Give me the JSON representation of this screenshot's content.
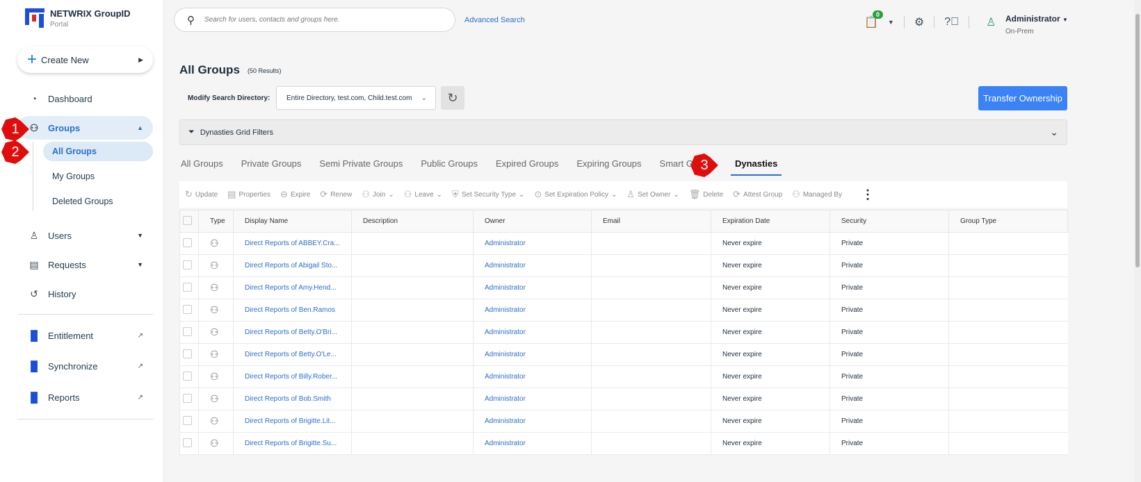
{
  "app": {
    "name": "NETWRIX GroupID",
    "sub": "Portal"
  },
  "sidebar": {
    "create": "Create New",
    "items": [
      {
        "label": "Dashboard"
      },
      {
        "label": "Groups"
      },
      {
        "label": "Users"
      },
      {
        "label": "Requests"
      },
      {
        "label": "History"
      },
      {
        "label": "Entitlement"
      },
      {
        "label": "Synchronize"
      },
      {
        "label": "Reports"
      }
    ],
    "sub": [
      "All Groups",
      "My Groups",
      "Deleted Groups"
    ]
  },
  "header": {
    "search_placeholder": "Search for users, contacts and groups here.",
    "advanced": "Advanced Search",
    "notif_count": "0",
    "user": "Administrator",
    "role": "On-Prem"
  },
  "page": {
    "title": "All Groups",
    "count": "(50 Results)",
    "modify_label": "Modify Search Directory:",
    "directory": "Entire Directory, test.com, Child.test.com",
    "transfer": "Transfer Ownership",
    "filters": "Dynasties Grid Filters"
  },
  "tabs": [
    "All Groups",
    "Private Groups",
    "Semi Private Groups",
    "Public Groups",
    "Expired Groups",
    "Expiring Groups",
    "Smart G",
    "Dynasties"
  ],
  "toolbar": [
    "Update",
    "Properties",
    "Expire",
    "Renew",
    "Join",
    "Leave",
    "Set Security Type",
    "Set Expiration Policy",
    "Set Owner",
    "Delete",
    "Attest Group",
    "Managed By"
  ],
  "table": {
    "columns": [
      "Type",
      "Display Name",
      "Description",
      "Owner",
      "Email",
      "Expiration Date",
      "Security",
      "Group Type"
    ],
    "rows": [
      {
        "name": "Direct Reports of ABBEY.Cra...",
        "owner": "Administrator",
        "exp": "Never expire",
        "sec": "Private"
      },
      {
        "name": "Direct Reports of Abigail Sto...",
        "owner": "Administrator",
        "exp": "Never expire",
        "sec": "Private"
      },
      {
        "name": "Direct Reports of Amy.Hend...",
        "owner": "Administrator",
        "exp": "Never expire",
        "sec": "Private"
      },
      {
        "name": "Direct Reports of Ben.Ramos",
        "owner": "Administrator",
        "exp": "Never expire",
        "sec": "Private"
      },
      {
        "name": "Direct Reports of Betty.O'Bri...",
        "owner": "Administrator",
        "exp": "Never expire",
        "sec": "Private"
      },
      {
        "name": "Direct Reports of Betty.O'Le...",
        "owner": "Administrator",
        "exp": "Never expire",
        "sec": "Private"
      },
      {
        "name": "Direct Reports of Billy.Rober...",
        "owner": "Administrator",
        "exp": "Never expire",
        "sec": "Private"
      },
      {
        "name": "Direct Reports of Bob.Smith",
        "owner": "Administrator",
        "exp": "Never expire",
        "sec": "Private"
      },
      {
        "name": "Direct Reports of Brigitte.Lit...",
        "owner": "Administrator",
        "exp": "Never expire",
        "sec": "Private"
      },
      {
        "name": "Direct Reports of Brigitte.Su...",
        "owner": "Administrator",
        "exp": "Never expire",
        "sec": "Private"
      }
    ]
  },
  "callouts": [
    "1",
    "2",
    "3"
  ]
}
